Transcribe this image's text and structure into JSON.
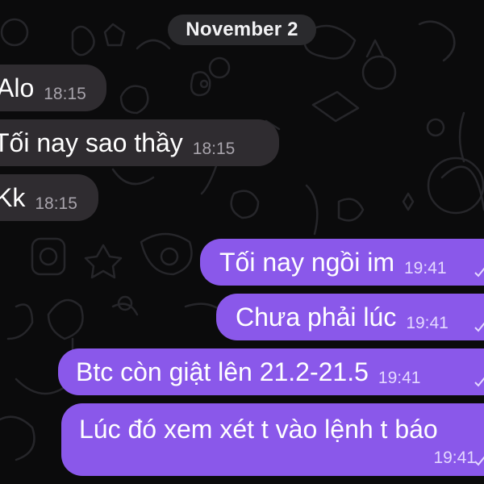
{
  "date_separator": "November 2",
  "messages": [
    {
      "direction": "incoming",
      "text": "Alo",
      "time": "18:15"
    },
    {
      "direction": "incoming",
      "text": "Tối nay sao thầy",
      "time": "18:15"
    },
    {
      "direction": "incoming",
      "text": "Kk",
      "time": "18:15"
    },
    {
      "direction": "outgoing",
      "text": "Tối nay ngồi im",
      "time": "19:41",
      "status_icon": "read-check-icon"
    },
    {
      "direction": "outgoing",
      "text": "Chưa phải lúc",
      "time": "19:41",
      "status_icon": "read-check-icon"
    },
    {
      "direction": "outgoing",
      "text": "Btc còn giật lên 21.2-21.5",
      "time": "19:41",
      "status_icon": "read-check-icon"
    },
    {
      "direction": "outgoing",
      "text": "Lúc đó xem xét t vào lệnh t báo",
      "time": "19:41",
      "status_icon": "read-check-icon"
    }
  ],
  "colors": {
    "background": "#0b0b0c",
    "incoming_bubble": "#2f2c30",
    "outgoing_bubble": "#8a58ea",
    "date_pill": "#2a2a2d"
  }
}
